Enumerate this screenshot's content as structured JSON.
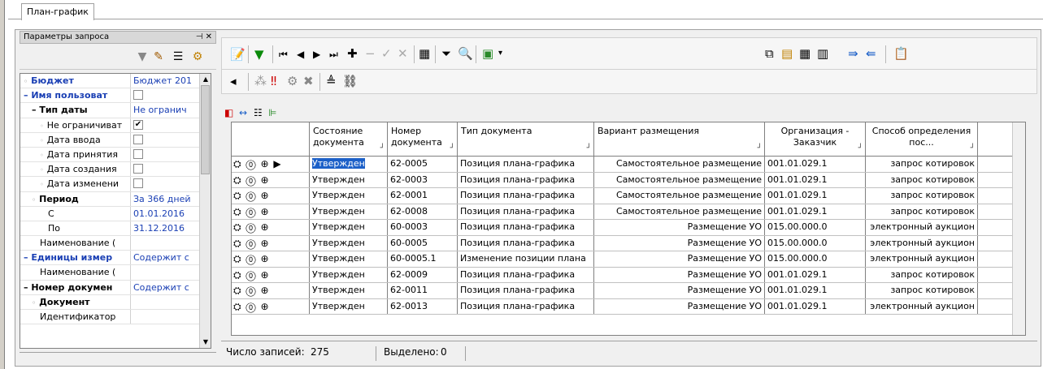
{
  "window_tab": "План-график",
  "left_panel": {
    "title": "Параметры запроса",
    "rows": [
      {
        "name": "Бюджет",
        "value": "Бюджет 201",
        "style": "blue",
        "dot": true
      },
      {
        "name": "– Имя пользоват",
        "value": "",
        "style": "blue",
        "checkbox": ""
      },
      {
        "name": "– Тип даты",
        "value": "Не огранич",
        "style": "bold",
        "indent": 1
      },
      {
        "name": "Не ограничиват",
        "value": "",
        "checkbox": "✔",
        "indent": 2,
        "dot": true
      },
      {
        "name": "Дата ввода",
        "value": "",
        "checkbox": "",
        "indent": 2,
        "dot": true
      },
      {
        "name": "Дата принятия",
        "value": "",
        "checkbox": "",
        "indent": 2,
        "dot": true
      },
      {
        "name": "Дата создания",
        "value": "",
        "checkbox": "",
        "indent": 2,
        "dot": true
      },
      {
        "name": "Дата изменени",
        "value": "",
        "checkbox": "",
        "indent": 2,
        "dot": true
      },
      {
        "name": "Период",
        "value": "За 366 дней",
        "style": "bold",
        "indent": 1,
        "dot": true
      },
      {
        "name": "С",
        "value": "01.01.2016",
        "indent": 3
      },
      {
        "name": "По",
        "value": "31.12.2016",
        "indent": 3
      },
      {
        "name": "Наименование (",
        "value": "",
        "indent": 2
      },
      {
        "name": "– Единицы измер",
        "value": "Содержит с",
        "style": "blue"
      },
      {
        "name": "Наименование (",
        "value": "",
        "indent": 2
      },
      {
        "name": "– Номер докумен",
        "value": "Содержит с",
        "style": "bold"
      },
      {
        "name": "Документ",
        "value": "",
        "style": "bold",
        "indent": 1,
        "dot": true
      },
      {
        "name": "Идентификатор",
        "value": "",
        "indent": 2
      }
    ]
  },
  "table": {
    "columns": [
      {
        "label": "",
        "key": "icons"
      },
      {
        "label": "Состояние документа",
        "key": "state"
      },
      {
        "label": "Номер документа",
        "key": "number"
      },
      {
        "label": "Тип документа",
        "key": "type"
      },
      {
        "label": "Вариант размещения",
        "key": "placement"
      },
      {
        "label": "Организация - Заказчик",
        "key": "org"
      },
      {
        "label": "Способ определения пос...",
        "key": "method"
      }
    ],
    "rows": [
      {
        "state": "Утвержден",
        "number": "62-0005",
        "type": "Позиция плана-графика",
        "placement": "Самостоятельное размещение",
        "org": "001.01.029.1",
        "method": "запрос котировок"
      },
      {
        "state": "Утвержден",
        "number": "62-0003",
        "type": "Позиция плана-графика",
        "placement": "Самостоятельное размещение",
        "org": "001.01.029.1",
        "method": "запрос котировок"
      },
      {
        "state": "Утвержден",
        "number": "62-0001",
        "type": "Позиция плана-графика",
        "placement": "Самостоятельное размещение",
        "org": "001.01.029.1",
        "method": "запрос котировок"
      },
      {
        "state": "Утвержден",
        "number": "62-0008",
        "type": "Позиция плана-графика",
        "placement": "Самостоятельное размещение",
        "org": "001.01.029.1",
        "method": "запрос котировок"
      },
      {
        "state": "Утвержден",
        "number": "60-0003",
        "type": "Позиция плана-графика",
        "placement": "Размещение УО",
        "org": "015.00.000.0",
        "method": "электронный аукцион"
      },
      {
        "state": "Утвержден",
        "number": "60-0005",
        "type": "Позиция плана-графика",
        "placement": "Размещение УО",
        "org": "015.00.000.0",
        "method": "электронный аукцион"
      },
      {
        "state": "Утвержден",
        "number": "60-0005.1",
        "type": "Изменение позиции плана",
        "placement": "Размещение УО",
        "org": "015.00.000.0",
        "method": "электронный аукцион"
      },
      {
        "state": "Утвержден",
        "number": "62-0009",
        "type": "Позиция плана-графика",
        "placement": "Размещение УО",
        "org": "001.01.029.1",
        "method": "запрос котировок"
      },
      {
        "state": "Утвержден",
        "number": "62-0011",
        "type": "Позиция плана-графика",
        "placement": "Размещение УО",
        "org": "001.01.029.1",
        "method": "запрос котировок"
      },
      {
        "state": "Утвержден",
        "number": "62-0013",
        "type": "Позиция плана-графика",
        "placement": "Размещение УО",
        "org": "001.01.029.1",
        "method": "электронный аукцион"
      }
    ]
  },
  "status": {
    "records_label": "Число записей:",
    "records_value": "275",
    "selected_label": "Выделено:",
    "selected_value": "0"
  },
  "colors": {
    "accent": "#1c60c8",
    "link_blue": "#1a3fb4",
    "chrome": "#f0f0f0"
  }
}
